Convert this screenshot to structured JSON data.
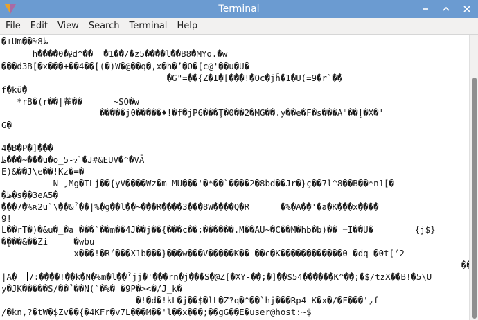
{
  "window": {
    "title": "Terminal"
  },
  "menu": [
    "File",
    "Edit",
    "View",
    "Search",
    "Terminal",
    "Help"
  ],
  "terminal": {
    "lines": [
      "�+Um��%8ظ",
      "      ħ����0�ɇd^��  �1��/�z5����l��B8�MYo.�w",
      "���d3B[�x���+��4��[(�)W�@��q�,x�h�’�O�[c@'��u�U�",
      "                                �G\"=��{Z�I�[���ً!�Oc�jĥ�1�U(=9�r`��",
      "f�kũ�",
      "   *rB�(r��|蒮��      ~SO�w",
      "                   �����j0�����♦!�f�jP6���Ţ�0��2�MG��.y��e�F�s���A\"��إ�X�'",
      "G�",
      "",
      "4�B�P�]���",
      "ظ���~���u�o_5-ɂ`�J#&EUV�^�VĀ",
      "E)&��J\\e��!Kz�=�",
      "          N-٫Mg�TLj��{yV����Wz�m MU���'�*��`����2�8bd��Jr�}ç��7l^8��B��*n1[�",
      "�ظ�s��3eA5�",
      "���7�%ʀ2u`\\��&ˀ��|%�g��l��~���R����3���8W����Q�R      �%�A��'�a�K���x����",
      "9!",
      "L��rT�)�&u�_�a ���`��m��4J��j��{���c��;������.M��AU~�C��M�hb�b)�� =I��U�        {j$}",
      "�̥���&��Zi     �wbu",
      "              x���!�Rˀ���X1b���}���w���V�����K�� ��c�K������������0 �dq_�0t[ˀ2",
      "                                                                                         ��",
      "|A�",
      "y�JK�����S/��ˀ��N(`�%� �9P�><�/J_k�",
      "                          �!�d�!kL�j��$�lL�Z?q�^��`hj���Rp4_K�x�/�F���'٫f",
      "/�kn,?�tW�$Zv��{�4KFr�v7L���M��'l��x���;��gG��E�user@host:~$"
    ],
    "cursor_line_rest": "7:����!��k�N�%m�l��ˀjj�'���rn�j���S�@Z[�XY-��;�]��$54������K^��;�$/tzX��B!�5\\U"
  }
}
